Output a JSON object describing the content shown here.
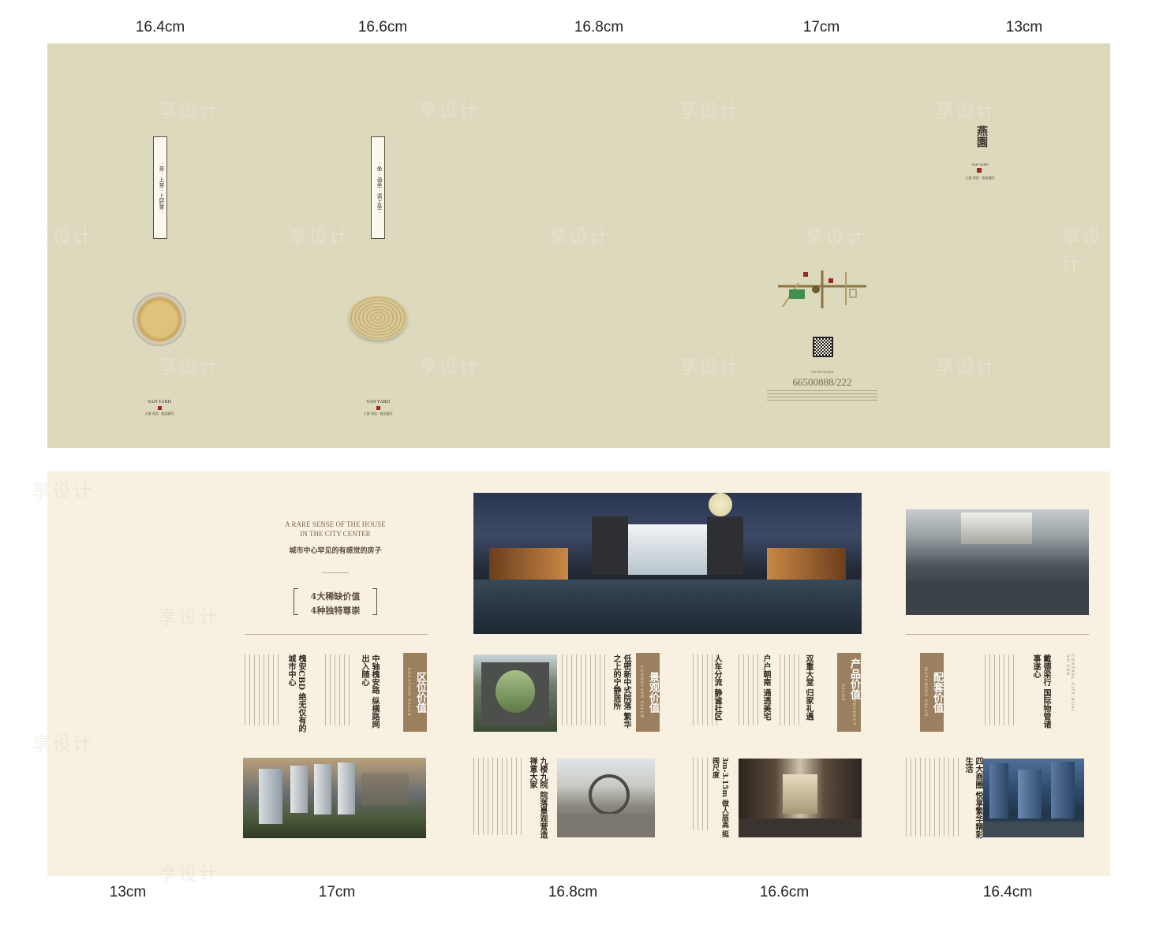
{
  "top_dimensions": [
    "16.4cm",
    "16.6cm",
    "16.8cm",
    "17cm",
    "13cm"
  ],
  "bottom_dimensions": [
    "13cm",
    "17cm",
    "16.8cm",
    "16.6cm",
    "16.4cm"
  ],
  "outer": {
    "card1_label": "· 茶 · 上茶 · 上好茶 ·",
    "card2_label": "· 坐 · 请坐 · 请上坐 ·",
    "brand": "YAN YARD",
    "brand_sub": "大唐·燕園 · 雅居藏院",
    "cover_logo": "燕園",
    "cover_logo_en": "YAN YARD",
    "cover_sub": "大唐·燕園 · 雅居藏院",
    "phone": "66500888/222",
    "hotline_label": "VIP HOTLINE",
    "watermark": "享设计"
  },
  "inner": {
    "intro_en_line1": "A RARE SENSE OF THE HOUSE",
    "intro_en_line2": "IN THE CITY CENTER",
    "intro_cn": "城市中心罕见的有感觉的房子",
    "highlight_line1": "4大稀缺价值",
    "highlight_line2": "4种独特尊崇",
    "sections": [
      {
        "tag": "区位价值",
        "tag_en": "LOCATION VALUE",
        "titles": [
          "中轴槐安路 纵横路网出入随心",
          "槐安CBD 绝无仅有的城市中心"
        ]
      },
      {
        "tag": "景观价值",
        "tag_en": "LANDSCAPE VALUE",
        "titles": [
          "低密新中式院落 繁华之上的宁静居所",
          "九楼九院 院落景观营造禅意大家"
        ]
      },
      {
        "tag": "产品价值",
        "tag_en": "PRODUCT VALUE",
        "titles": [
          "双重大堂 归家礼遇",
          "户户朝南 通透美宅",
          "人车分流 静谧社区",
          "3m-3.15m 做人层高 挺阔尺度"
        ]
      },
      {
        "tag": "配套价值",
        "tag_en": "MATCHING VALUE",
        "titles": [
          "戴德梁行 国际物管诸事遂心",
          "四大商圈 悦享繁华精彩生活"
        ],
        "side_en": "CENTRAL CITY HUAI AN CBD"
      }
    ]
  }
}
